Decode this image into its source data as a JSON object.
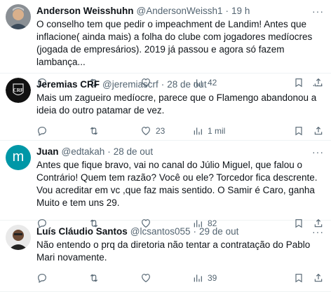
{
  "tweets": [
    {
      "name": "Anderson Weisshuhn",
      "handle": "@AndersonWeissh1",
      "time": "19 h",
      "text": "O conselho tem que pedir o impeachment de Landim! Antes que inflacione( ainda mais) a folha do clube com jogadores medíocres (jogada de empresários). 2019 já passou e agora só fazem lambança...",
      "likes": "",
      "views": "42",
      "avatar": "person-photo"
    },
    {
      "name": "Jeremias CRF",
      "handle": "@jeremiascrf",
      "time": "28 de out",
      "text": "Mais um zagueiro medíocre, parece que o Flamengo abandonou a ideia do outro patamar de vez.",
      "likes": "23",
      "views": "1 mil",
      "avatar": "flamengo-crest"
    },
    {
      "name": "Juan",
      "handle": "@edtakah",
      "time": "28 de out",
      "text": "Antes que fique bravo, vai no canal do Júlio Miguel, que falou o Contrário! Quem tem razão? Você ou ele? Torcedor fica descrente. Vou acreditar em vc ,que faz mais sentido. O Samir é Caro, ganha Muito e tem uns 29.",
      "likes": "",
      "views": "82",
      "avatar_letter": "m",
      "avatar_color": "#0097a7"
    },
    {
      "name": "Luís Cláudio Santos",
      "handle": "@lcsantos055",
      "time": "29 de out",
      "text": "Não entendo o prq da diretoria não tentar a contratação do Pablo Mari novamente.",
      "likes": "",
      "views": "39",
      "avatar": "person-photo"
    }
  ],
  "colors": {
    "secondary": "#536471",
    "text": "#0f1419",
    "divider": "#eff3f4"
  }
}
